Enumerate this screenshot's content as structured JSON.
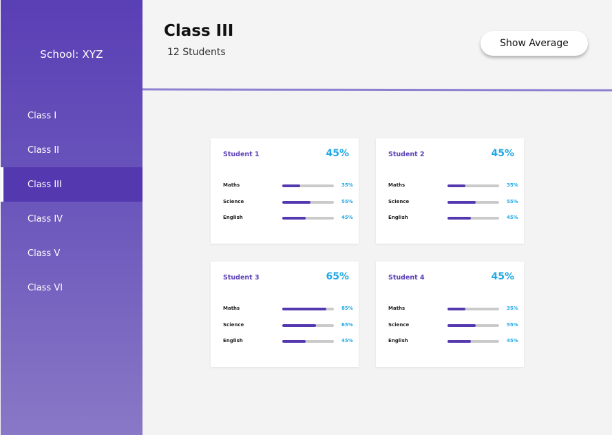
{
  "sidebar": {
    "school": "School: XYZ",
    "items": [
      {
        "label": "Class I",
        "active": false
      },
      {
        "label": "Class II",
        "active": false
      },
      {
        "label": "Class III",
        "active": true
      },
      {
        "label": "Class IV",
        "active": false
      },
      {
        "label": "Class V",
        "active": false
      },
      {
        "label": "Class VI",
        "active": false
      }
    ]
  },
  "header": {
    "title": "Class III",
    "subtitle": "12 Students",
    "show_average_label": "Show Average"
  },
  "students": [
    {
      "name": "Student 1",
      "average": "45%",
      "subjects": [
        {
          "name": "Maths",
          "percent": "35%",
          "value": 35
        },
        {
          "name": "Science",
          "percent": "55%",
          "value": 55
        },
        {
          "name": "English",
          "percent": "45%",
          "value": 45
        }
      ]
    },
    {
      "name": "Student 2",
      "average": "45%",
      "subjects": [
        {
          "name": "Maths",
          "percent": "35%",
          "value": 35
        },
        {
          "name": "Science",
          "percent": "55%",
          "value": 55
        },
        {
          "name": "English",
          "percent": "45%",
          "value": 45
        }
      ]
    },
    {
      "name": "Student 3",
      "average": "65%",
      "subjects": [
        {
          "name": "Maths",
          "percent": "85%",
          "value": 85
        },
        {
          "name": "Science",
          "percent": "65%",
          "value": 65
        },
        {
          "name": "English",
          "percent": "45%",
          "value": 45
        }
      ]
    },
    {
      "name": "Student 4",
      "average": "45%",
      "subjects": [
        {
          "name": "Maths",
          "percent": "35%",
          "value": 35
        },
        {
          "name": "Science",
          "percent": "55%",
          "value": 55
        },
        {
          "name": "English",
          "percent": "45%",
          "value": 45
        }
      ]
    }
  ],
  "colors": {
    "accent": "#5438b0",
    "percent": "#21a8e6",
    "track": "#cacaca"
  }
}
